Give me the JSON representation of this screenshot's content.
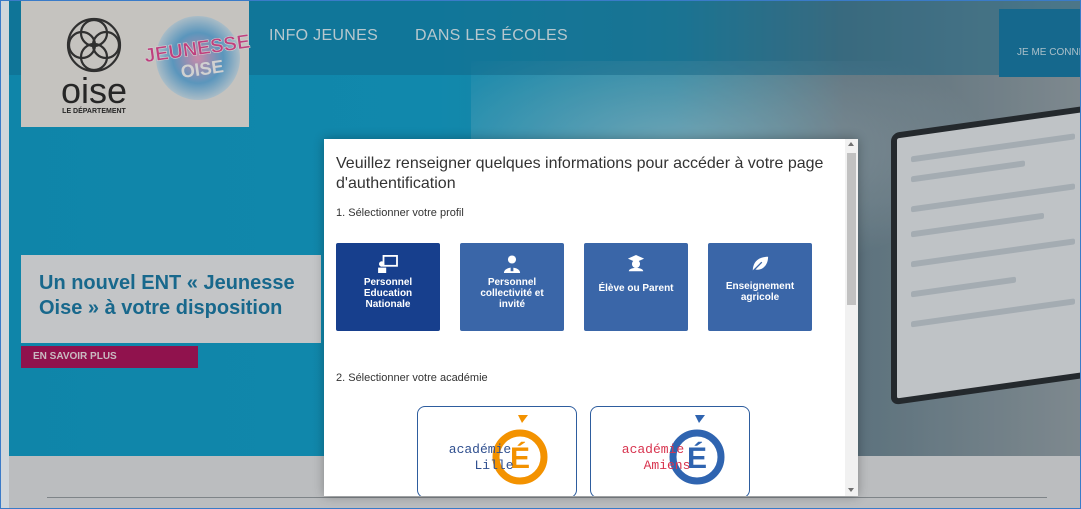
{
  "header": {
    "nav": [
      "INFO JEUNES",
      "DANS LES ÉCOLES"
    ],
    "connect_label": "JE ME CONNECTE",
    "logo_text": "oise",
    "logo_subtext": "LE DÉPARTEMENT",
    "jeunesse_logo_line1": "JEUNESSE",
    "jeunesse_logo_line2": "OISE"
  },
  "promo": {
    "title": "Un nouvel ENT « Jeunesse Oise » à votre disposition",
    "button_label": "EN SAVOIR PLUS"
  },
  "modal": {
    "title": "Veuillez renseigner quelques informations pour accéder à votre page d'authentification",
    "step1": "1. Sélectionner votre profil",
    "profiles": [
      {
        "label": "Personnel Education Nationale",
        "icon": "teacher-board-icon",
        "selected": true
      },
      {
        "label": "Personnel collectivité et invité",
        "icon": "staff-person-icon",
        "selected": false
      },
      {
        "label": "Élève ou Parent",
        "icon": "graduation-cap-icon",
        "selected": false
      },
      {
        "label": "Enseignement agricole",
        "icon": "leaf-icon",
        "selected": false
      }
    ],
    "step2": "2. Sélectionner votre académie",
    "academies": [
      {
        "line1": "académie",
        "line2": "Lille",
        "letter": "É",
        "ring_color": "#f39200"
      },
      {
        "line1": "académie",
        "line2": "Amiens",
        "letter": "É",
        "ring_color": "#2f64b0"
      }
    ]
  },
  "colors": {
    "primary_blue": "#3a66a8",
    "selected_blue": "#173f8d",
    "promo_magenta": "#b0175e",
    "hero_cyan": "#15a6d2"
  }
}
